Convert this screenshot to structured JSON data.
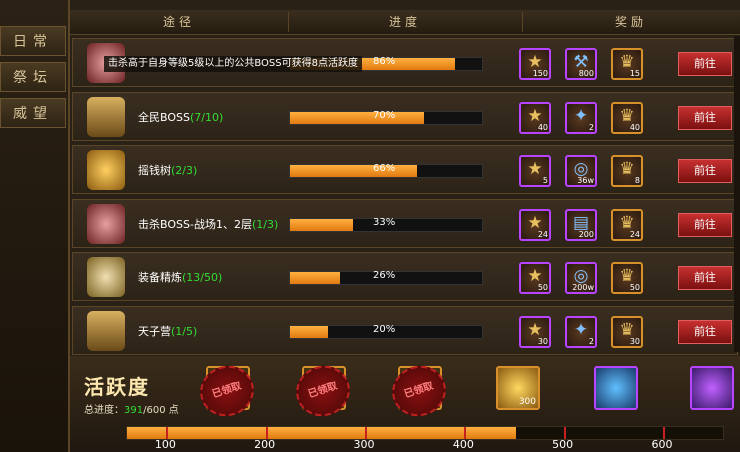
{
  "side_tabs": [
    {
      "label": "日常",
      "active": true
    },
    {
      "label": "祭坛",
      "active": false
    },
    {
      "label": "威望",
      "active": false
    }
  ],
  "header": {
    "col1": "途径",
    "col2": "进度",
    "col3": "奖励"
  },
  "go_label": "前往",
  "tooltip": "击杀高于自身等级5级以上的公共BOSS可获得8点活跃度",
  "rows": [
    {
      "name": "",
      "count": "",
      "progress": 86,
      "pct_label": "86%",
      "icon": "boss-icon",
      "rewards": [
        {
          "icon": "star-medal-icon",
          "count": "150",
          "rarity": "purple"
        },
        {
          "icon": "hammer-icon",
          "count": "800",
          "rarity": "purple"
        },
        {
          "icon": "trophy-icon",
          "count": "15",
          "rarity": "orange"
        }
      ]
    },
    {
      "name": "全民BOSS",
      "count": "(7/10)",
      "progress": 70,
      "pct_label": "70%",
      "icon": "warrior-icon",
      "rewards": [
        {
          "icon": "star-medal-icon",
          "count": "40",
          "rarity": "purple"
        },
        {
          "icon": "crystal-icon",
          "count": "2",
          "rarity": "purple"
        },
        {
          "icon": "trophy-icon",
          "count": "40",
          "rarity": "orange"
        }
      ]
    },
    {
      "name": "摇钱树",
      "count": "(2/3)",
      "progress": 66,
      "pct_label": "66%",
      "icon": "money-tree-icon",
      "rewards": [
        {
          "icon": "star-medal-icon",
          "count": "5",
          "rarity": "purple"
        },
        {
          "icon": "coins-icon",
          "count": "36w",
          "rarity": "purple"
        },
        {
          "icon": "trophy-icon",
          "count": "8",
          "rarity": "orange"
        }
      ]
    },
    {
      "name": "击杀BOSS-战场1、2层",
      "count": "(1/3)",
      "progress": 33,
      "pct_label": "33%",
      "icon": "boss-icon",
      "rewards": [
        {
          "icon": "star-medal-icon",
          "count": "24",
          "rarity": "purple"
        },
        {
          "icon": "scroll-icon",
          "count": "200",
          "rarity": "purple"
        },
        {
          "icon": "trophy-icon",
          "count": "24",
          "rarity": "orange"
        }
      ]
    },
    {
      "name": "装备精炼",
      "count": "(13/50)",
      "progress": 26,
      "pct_label": "26%",
      "icon": "crossed-swords-icon",
      "rewards": [
        {
          "icon": "star-medal-icon",
          "count": "50",
          "rarity": "purple"
        },
        {
          "icon": "coins-icon",
          "count": "200w",
          "rarity": "purple"
        },
        {
          "icon": "trophy-icon",
          "count": "50",
          "rarity": "orange"
        }
      ]
    },
    {
      "name": "天子营",
      "count": "(1/5)",
      "progress": 20,
      "pct_label": "20%",
      "icon": "warrior-icon",
      "rewards": [
        {
          "icon": "star-medal-icon",
          "count": "30",
          "rarity": "purple"
        },
        {
          "icon": "crystal-icon",
          "count": "2",
          "rarity": "purple"
        },
        {
          "icon": "trophy-icon",
          "count": "30",
          "rarity": "orange"
        }
      ]
    }
  ],
  "activity": {
    "title": "活跃度",
    "total_prefix": "总进度：",
    "current": "391",
    "total_suffix": "/600 点",
    "progress": 0.652,
    "milestones": [
      "100",
      "200",
      "300",
      "400",
      "500",
      "600"
    ],
    "chests": [
      {
        "icon": "chest-icon",
        "claimed": true,
        "stamp": "已领取",
        "count": ""
      },
      {
        "icon": "chest-icon",
        "claimed": true,
        "stamp": "已领取",
        "count": ""
      },
      {
        "icon": "chest-icon",
        "claimed": true,
        "stamp": "已领取",
        "count": ""
      },
      {
        "icon": "gold-ingot-icon",
        "claimed": false,
        "stamp": "",
        "count": "300"
      },
      {
        "icon": "blue-dragon-icon",
        "claimed": false,
        "stamp": "",
        "count": ""
      },
      {
        "icon": "purple-dragon-icon",
        "claimed": false,
        "stamp": "",
        "count": ""
      }
    ]
  },
  "colors": {
    "purple_border": "#b844ff",
    "orange_border": "#d8902a",
    "go_button": "#c83030",
    "progress_fill": "#f0901c",
    "count_green": "#33dd33"
  }
}
